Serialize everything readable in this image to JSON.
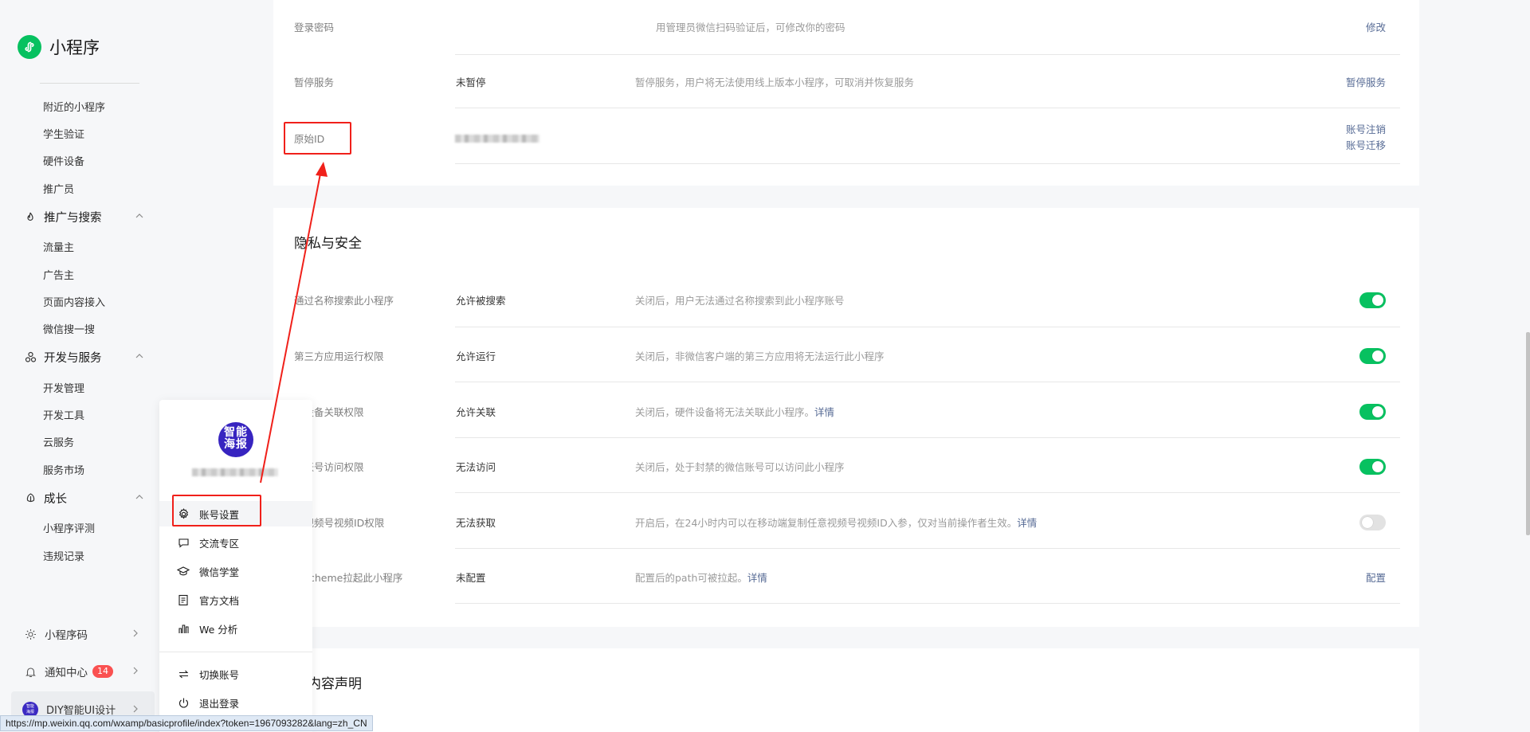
{
  "app": {
    "title": "小程序"
  },
  "sidebar": {
    "top_items": [
      "附近的小程序",
      "学生验证",
      "硬件设备",
      "推广员"
    ],
    "groups": [
      {
        "label": "推广与搜索",
        "items": [
          "流量主",
          "广告主",
          "页面内容接入",
          "微信搜一搜"
        ]
      },
      {
        "label": "开发与服务",
        "items": [
          "开发管理",
          "开发工具",
          "云服务",
          "服务市场"
        ]
      },
      {
        "label": "成长",
        "items": [
          "小程序评测",
          "违规记录"
        ]
      }
    ],
    "bottom": [
      {
        "label": "小程序码"
      },
      {
        "label": "通知中心",
        "badge": "14"
      },
      {
        "label": "DIY智能UI设计"
      }
    ]
  },
  "account_card": {
    "rows": [
      {
        "label": "登录密码",
        "value": "",
        "desc": "用管理员微信扫码验证后，可修改你的密码",
        "action": "修改"
      },
      {
        "label": "暂停服务",
        "value": "未暂停",
        "desc": "暂停服务，用户将无法使用线上版本小程序，可取消并恢复服务",
        "action": "暂停服务"
      },
      {
        "label": "原始ID",
        "value": "",
        "desc": "",
        "action": "账号注销",
        "action2": "账号迁移"
      }
    ]
  },
  "privacy": {
    "title": "隐私与安全",
    "rows": [
      {
        "label": "通过名称搜索此小程序",
        "value": "允许被搜索",
        "desc": "关闭后，用户无法通过名称搜索到此小程序账号",
        "link": "",
        "toggle": true
      },
      {
        "label": "第三方应用运行权限",
        "value": "允许运行",
        "desc": "关闭后，非微信客户端的第三方应用将无法运行此小程序",
        "link": "",
        "toggle": true
      },
      {
        "label": "件设备关联权限",
        "value": "允许关联",
        "desc": "关闭后，硬件设备将无法关联此小程序。",
        "link": "详情",
        "toggle": true
      },
      {
        "label": "禁账号访问权限",
        "value": "无法访问",
        "desc": "关闭后，处于封禁的微信账号可以访问此小程序",
        "link": "",
        "toggle": true
      },
      {
        "label": "取视频号视频ID权限",
        "value": "无法获取",
        "desc": "开启后，在24小时内可以在移动端复制任意视频号视频ID入参，仅对当前操作者生效。",
        "link": "详情",
        "toggle": false
      },
      {
        "label": "过scheme拉起此小程序",
        "value": "未配置",
        "desc": "配置后的path可被拉起。",
        "link": "详情",
        "action": "配置"
      }
    ]
  },
  "service_section": {
    "title": "务内容声明"
  },
  "popup": {
    "avatar_text": "智能海报",
    "items": [
      {
        "label": "账号设置",
        "icon": "gear-icon"
      },
      {
        "label": "交流专区",
        "icon": "chat-icon"
      },
      {
        "label": "微信学堂",
        "icon": "graduation-cap-icon"
      },
      {
        "label": "官方文档",
        "icon": "document-icon"
      },
      {
        "label": "We 分析",
        "icon": "chart-icon"
      }
    ],
    "bottom_items": [
      {
        "label": "切换账号",
        "icon": "switch-icon"
      },
      {
        "label": "退出登录",
        "icon": "power-icon"
      }
    ]
  },
  "status_bar": {
    "url": "https://mp.weixin.qq.com/wxamp/basicprofile/index?token=1967093282&lang=zh_CN"
  },
  "colors": {
    "brand": "#07c160",
    "link": "#576b95",
    "annotation": "#f0201a",
    "badge": "#fa5151"
  }
}
